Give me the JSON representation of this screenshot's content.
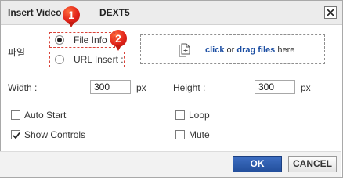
{
  "dialog": {
    "title": "Insert Video",
    "title_suffix": "DEXT5",
    "close_icon": "close-icon"
  },
  "markers": [
    "1",
    "2"
  ],
  "source": {
    "label": "파일",
    "options": [
      {
        "label": "File Info",
        "selected": true
      },
      {
        "label": "URL Insert :",
        "selected": false
      }
    ]
  },
  "dropzone": {
    "icon": "file-upload-icon",
    "click_text": "click",
    "or_text": "or",
    "drag_text": "drag files",
    "here_text": "here"
  },
  "size": {
    "width_label": "Width :",
    "width_value": "300",
    "width_unit": "px",
    "height_label": "Height :",
    "height_value": "300",
    "height_unit": "px"
  },
  "options": {
    "auto_start": {
      "label": "Auto Start",
      "checked": false
    },
    "show_controls": {
      "label": "Show Controls",
      "checked": true
    },
    "loop": {
      "label": "Loop",
      "checked": false
    },
    "mute": {
      "label": "Mute",
      "checked": false
    }
  },
  "buttons": {
    "ok": "OK",
    "cancel": "CANCEL"
  },
  "colors": {
    "ok_button": "#2b5bad",
    "marker": "#e2241a",
    "link": "#1d4fa3"
  }
}
